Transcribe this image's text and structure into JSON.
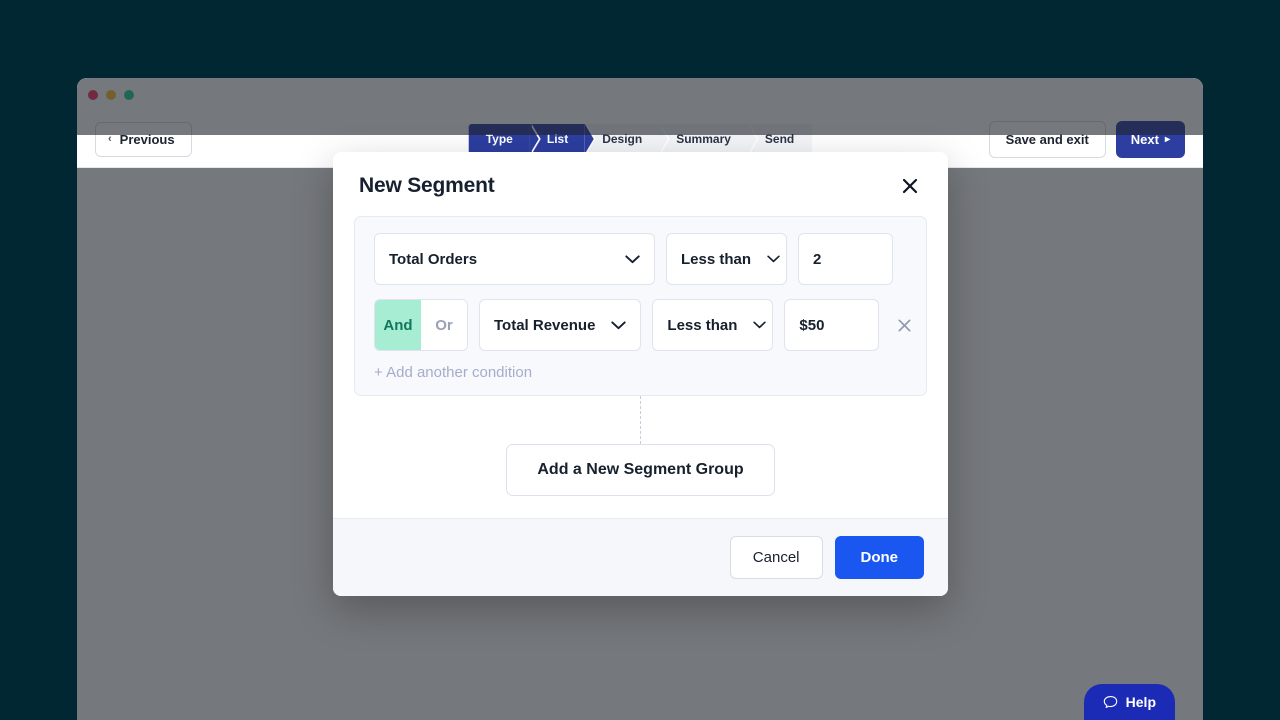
{
  "theme": {
    "page_background": "#012733",
    "accent_blue": "#1a56f0",
    "nav_blue": "#2c3ea0",
    "help_blue": "#1c2bb5",
    "and_green_bg": "#a7edd3",
    "and_green_text": "#12775c",
    "overlay": "rgba(33,37,43,0.62)"
  },
  "browser": {
    "dots": [
      "red",
      "yellow",
      "green"
    ]
  },
  "topbar": {
    "previous_label": "Previous",
    "previous_chevron": "‹",
    "save_exit_label": "Save and exit",
    "next_label": "Next",
    "next_arrow": "▸",
    "steps": [
      {
        "label": "Type",
        "active": true
      },
      {
        "label": "List",
        "active": true
      },
      {
        "label": "Design",
        "active": false
      },
      {
        "label": "Summary",
        "active": false
      },
      {
        "label": "Send",
        "active": false
      }
    ]
  },
  "modal": {
    "title": "New Segment",
    "close_icon": "close-icon",
    "conditions": [
      {
        "connector": null,
        "attribute": "Total Orders",
        "operator": "Less than",
        "value": "2",
        "removable": false
      },
      {
        "connector": {
          "and_label": "And",
          "or_label": "Or",
          "selected": "And"
        },
        "attribute": "Total Revenue",
        "operator": "Less than",
        "value": "$50",
        "removable": true
      }
    ],
    "add_condition_label": "+ Add another condition",
    "add_group_label": "Add a New Segment Group",
    "footer": {
      "cancel_label": "Cancel",
      "done_label": "Done"
    }
  },
  "help": {
    "label": "Help",
    "icon": "chat-bubble-icon"
  }
}
